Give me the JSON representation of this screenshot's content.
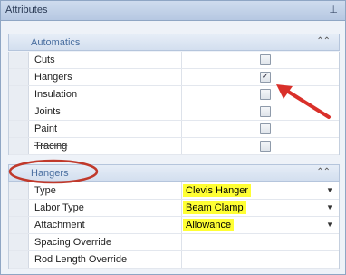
{
  "panel": {
    "title": "Attributes",
    "pin_icon": "pin-icon"
  },
  "groups": {
    "automatics": {
      "title": "Automatics",
      "rows": [
        {
          "label": "Cuts",
          "checked": false
        },
        {
          "label": "Hangers",
          "checked": true
        },
        {
          "label": "Insulation",
          "checked": false
        },
        {
          "label": "Joints",
          "checked": false
        },
        {
          "label": "Paint",
          "checked": false
        },
        {
          "label": "Tracing",
          "checked": false
        }
      ]
    },
    "hangers": {
      "title": "Hangers",
      "rows": [
        {
          "label": "Type",
          "value": "Clevis Hanger"
        },
        {
          "label": "Labor Type",
          "value": "Beam Clamp"
        },
        {
          "label": "Attachment",
          "value": "Allowance"
        },
        {
          "label": "Spacing Override",
          "value": ""
        },
        {
          "label": "Rod Length Override",
          "value": ""
        }
      ]
    }
  },
  "glyphs": {
    "check": "✓",
    "collapse": "⌃⌃",
    "dropdown": "▼",
    "pin": "⊥"
  },
  "colors": {
    "highlight": "#ffff33",
    "annotation": "#d9302a"
  }
}
